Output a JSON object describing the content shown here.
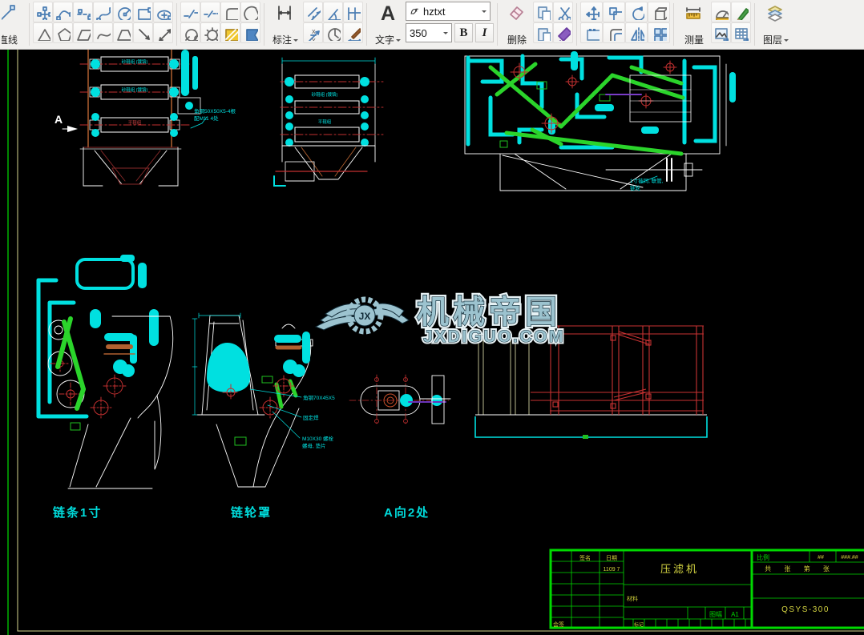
{
  "toolbar": {
    "line_label": "直线",
    "dim_label": "标注",
    "text_label": "文字",
    "text_big_icon": "A",
    "font_name": "hztxt",
    "font_size": "350",
    "bold": "B",
    "italic": "I",
    "delete_label": "删除",
    "measure_label": "测量",
    "layer_label": "图层"
  },
  "watermark": {
    "monogram": "JX",
    "brand": "机械帝国",
    "site": "JXDIGUO.COM"
  },
  "canvas": {
    "view_marker": "A",
    "captions": {
      "chain": "链条1寸",
      "cover": "链轮罩",
      "view_a": "A向2处"
    },
    "notes": {
      "front_1": "角钢50X50X5-4根",
      "front_2": "配M11 4处",
      "side_1": "1寸链同, 联管,",
      "side_2": "链轮",
      "cover_1": "角钢70X45X5",
      "cover_2": "固定焊",
      "cover_3": "M10X30 螺栓",
      "cover_4": "螺母, 垫片",
      "roller_1": "砂辊组 (镀铬)",
      "roller_2": "砂辊组 (镀铬)",
      "roller_3": "平辊组",
      "roller_b1": "砂辊组 (镀铬)",
      "roller_b2": "平辊组"
    }
  },
  "title_block": {
    "sign": "签名",
    "date": "日期",
    "date_value": "1109 7",
    "title": "压滤机",
    "material": "材料",
    "sheet_label": "图幅",
    "sheet": "A1",
    "mark": "标记",
    "countersign": "会签",
    "scale": "比例",
    "val1": "##",
    "val2": "###.##",
    "pages": "共 张 第 张",
    "number": "QSYS-300"
  },
  "colors": {
    "cyan": "#00e0e0",
    "chain_green": "#2bd42b",
    "red": "#c23030",
    "orange": "#b06030",
    "sheet_green": "#00d800",
    "yellow_text": "#d6d642",
    "watermark_teal": "#9cc3cf"
  }
}
